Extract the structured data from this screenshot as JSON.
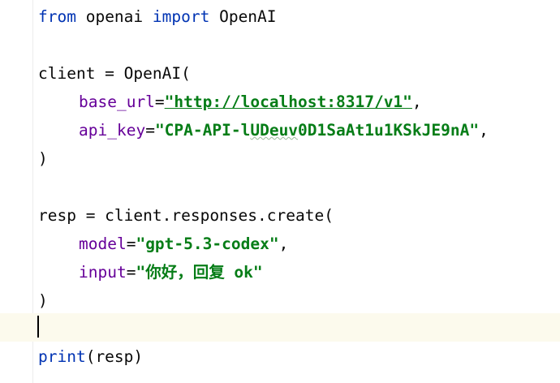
{
  "lines": {
    "l1": {
      "kw_from": "from",
      "module": " openai ",
      "kw_import": "import",
      "name": " OpenAI"
    },
    "l3": {
      "text": "client = OpenAI("
    },
    "l4": {
      "param": "base_url",
      "eq": "=",
      "url": "\"http://localhost:8317/v1\"",
      "comma": ","
    },
    "l5": {
      "param": "api_key",
      "eq": "=",
      "str_a": "\"CPA-API-l",
      "str_typo": "UDeuv",
      "str_b": "0D1SaAt1u1KSkJE9nA\"",
      "comma": ","
    },
    "l6": {
      "text": ")"
    },
    "l8": {
      "text": "resp = client.responses.create("
    },
    "l9": {
      "param": "model",
      "eq": "=",
      "str": "\"gpt-5.3-codex\"",
      "comma": ","
    },
    "l10": {
      "param": "input",
      "eq": "=",
      "str": "\"你好，回复 ok\""
    },
    "l11": {
      "text": ")"
    },
    "l13": {
      "fn": "print",
      "args": "(resp)"
    }
  },
  "colors": {
    "keyword": "#0033b3",
    "parameter": "#660099",
    "string": "#067d17",
    "current_line": "#fcfaed"
  }
}
